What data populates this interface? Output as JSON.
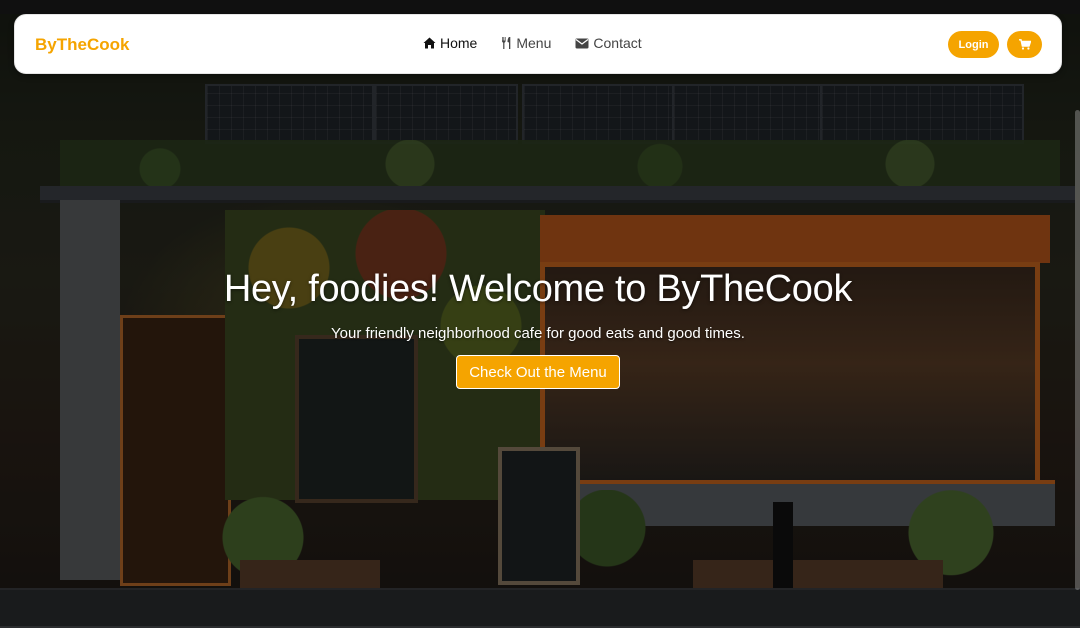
{
  "brand": {
    "name": "ByTheCook",
    "color": "#f5a400"
  },
  "nav": {
    "items": [
      {
        "label": "Home",
        "icon": "home-icon",
        "active": true
      },
      {
        "label": "Menu",
        "icon": "utensils-icon",
        "active": false
      },
      {
        "label": "Contact",
        "icon": "envelope-icon",
        "active": false
      }
    ],
    "login_label": "Login",
    "cart_icon": "cart-icon"
  },
  "hero": {
    "title": "Hey, foodies! Welcome to ByTheCook",
    "subtitle": "Your friendly neighborhood cafe for good eats and good times.",
    "cta_label": "Check Out the Menu"
  },
  "colors": {
    "accent": "#f5a400",
    "navbar_bg": "#ffffff",
    "text_dark": "#2b2b2b"
  }
}
